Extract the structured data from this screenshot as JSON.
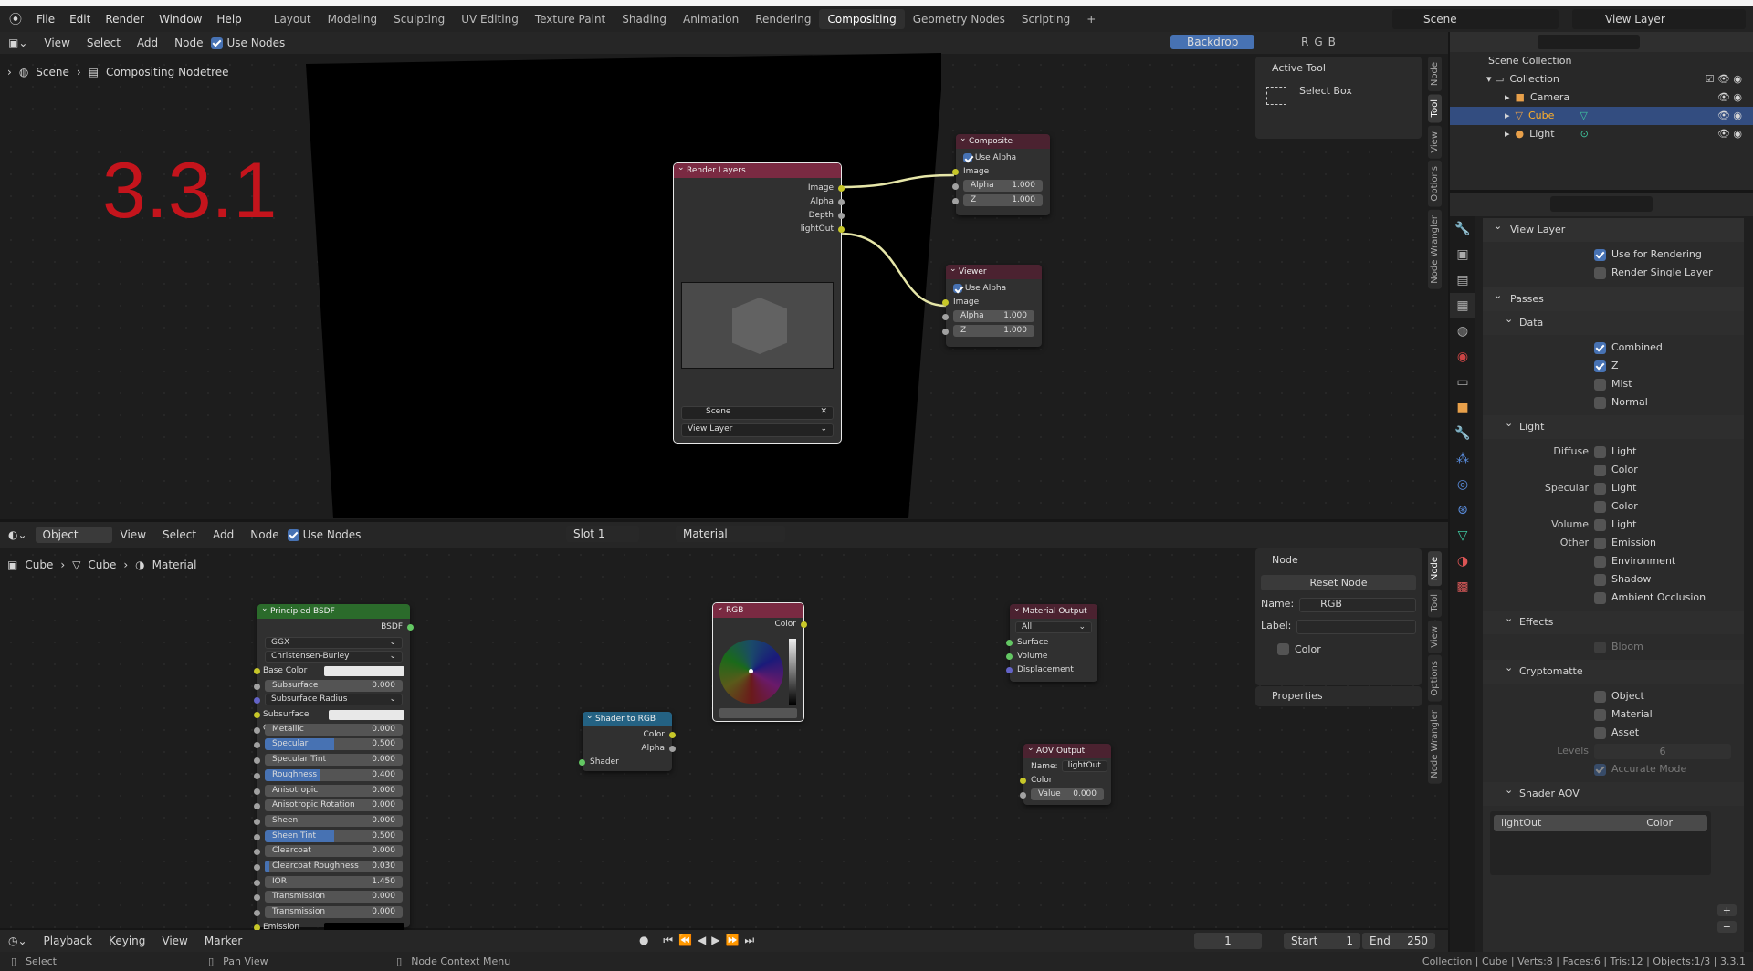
{
  "topbar": {
    "menus": [
      "File",
      "Edit",
      "Render",
      "Window",
      "Help"
    ],
    "workspaces": [
      "Layout",
      "Modeling",
      "Sculpting",
      "UV Editing",
      "Texture Paint",
      "Shading",
      "Animation",
      "Rendering",
      "Compositing",
      "Geometry Nodes",
      "Scripting"
    ],
    "active_workspace": "Compositing",
    "add": "+",
    "scene": "Scene",
    "view_layer": "View Layer"
  },
  "compositor": {
    "menus": [
      "View",
      "Select",
      "Add",
      "Node"
    ],
    "use_nodes": "Use Nodes",
    "backdrop": "Backdrop",
    "channels": [
      "R",
      "G",
      "B"
    ],
    "breadcrumb": [
      "Scene",
      "Compositing Nodetree"
    ],
    "version_watermark": "3.3.1",
    "render_layers": {
      "title": "Render Layers",
      "outputs": [
        "Image",
        "Alpha",
        "Depth",
        "lightOut"
      ],
      "scene": "Scene",
      "view_layer": "View Layer"
    },
    "composite": {
      "title": "Composite",
      "use_alpha": "Use Alpha",
      "input": "Image",
      "alpha_label": "Alpha",
      "alpha": "1.000",
      "z_label": "Z",
      "z": "1.000"
    },
    "viewer": {
      "title": "Viewer",
      "use_alpha": "Use Alpha",
      "input": "Image",
      "alpha_label": "Alpha",
      "alpha": "1.000",
      "z_label": "Z",
      "z": "1.000"
    },
    "npanel": {
      "title": "Active Tool",
      "tool": "Select Box"
    },
    "tabs": [
      "Node",
      "Tool",
      "View",
      "Options",
      "Node Wrangler"
    ]
  },
  "shader": {
    "mode": "Object",
    "menus": [
      "View",
      "Select",
      "Add",
      "Node"
    ],
    "use_nodes": "Use Nodes",
    "slot": "Slot 1",
    "material": "Material",
    "breadcrumb": [
      "Cube",
      "Cube",
      "Material"
    ],
    "principled": {
      "title": "Principled BSDF",
      "output": "BSDF",
      "distribution": "GGX",
      "subsurface_method": "Christensen-Burley",
      "rows": [
        {
          "label": "Base Color",
          "type": "color",
          "color": "#e8e8e8",
          "socket": "yel"
        },
        {
          "label": "Subsurface",
          "value": "0.000",
          "fill": 0,
          "socket": "gry"
        },
        {
          "label": "Subsurface Radius",
          "type": "drop",
          "socket": "pur"
        },
        {
          "label": "Subsurface Color",
          "type": "color",
          "color": "#e8e8e8",
          "socket": "yel"
        },
        {
          "label": "Metallic",
          "value": "0.000",
          "fill": 0,
          "socket": "gry"
        },
        {
          "label": "Specular",
          "value": "0.500",
          "fill": 0.5,
          "socket": "gry"
        },
        {
          "label": "Specular Tint",
          "value": "0.000",
          "fill": 0,
          "socket": "gry"
        },
        {
          "label": "Roughness",
          "value": "0.400",
          "fill": 0.4,
          "socket": "gry"
        },
        {
          "label": "Anisotropic",
          "value": "0.000",
          "fill": 0,
          "socket": "gry"
        },
        {
          "label": "Anisotropic Rotation",
          "value": "0.000",
          "fill": 0,
          "socket": "gry"
        },
        {
          "label": "Sheen",
          "value": "0.000",
          "fill": 0,
          "socket": "gry"
        },
        {
          "label": "Sheen Tint",
          "value": "0.500",
          "fill": 0.5,
          "socket": "gry"
        },
        {
          "label": "Clearcoat",
          "value": "0.000",
          "fill": 0,
          "socket": "gry"
        },
        {
          "label": "Clearcoat Roughness",
          "value": "0.030",
          "fill": 0.03,
          "socket": "gry"
        },
        {
          "label": "IOR",
          "value": "1.450",
          "fill": 0,
          "socket": "gry"
        },
        {
          "label": "Transmission",
          "value": "0.000",
          "fill": 0,
          "socket": "gry"
        },
        {
          "label": "Transmission Roughness",
          "value": "0.000",
          "fill": 0,
          "socket": "gry"
        },
        {
          "label": "Emission",
          "type": "color",
          "color": "#000000",
          "socket": "yel"
        }
      ]
    },
    "shader_to_rgb": {
      "title": "Shader to RGB",
      "outputs": [
        "Color",
        "Alpha"
      ],
      "input": "Shader"
    },
    "rgb": {
      "title": "RGB",
      "output": "Color"
    },
    "material_output": {
      "title": "Material Output",
      "target": "All",
      "inputs": [
        "Surface",
        "Volume",
        "Displacement"
      ]
    },
    "aov_output": {
      "title": "AOV Output",
      "name_label": "Name:",
      "name": "lightOut",
      "input": "Color",
      "value_label": "Value",
      "value": "0.000"
    },
    "npanel": {
      "title": "Node",
      "reset": "Reset Node",
      "name_label": "Name:",
      "name": "RGB",
      "label_label": "Label:",
      "label": "",
      "color": "Color",
      "properties": "Properties"
    },
    "tabs": [
      "Node",
      "Tool",
      "View",
      "Options",
      "Node Wrangler"
    ]
  },
  "timeline": {
    "menus": [
      "Playback",
      "Keying",
      "View",
      "Marker"
    ],
    "current_frame": "1",
    "start_label": "Start",
    "start": "1",
    "end_label": "End",
    "end": "250"
  },
  "outliner": {
    "root": "Scene Collection",
    "collection": "Collection",
    "items": [
      {
        "name": "Camera",
        "color": "#e8a04a"
      },
      {
        "name": "Cube",
        "color": "#e8a04a",
        "selected": true
      },
      {
        "name": "Light",
        "color": "#e8a04a"
      }
    ]
  },
  "properties": {
    "view_layer": {
      "title": "View Layer",
      "use_for_rendering": "Use for Rendering",
      "render_single_layer": "Render Single Layer"
    },
    "passes": {
      "title": "Passes",
      "data": {
        "title": "Data",
        "items": [
          {
            "label": "Combined",
            "checked": true
          },
          {
            "label": "Z",
            "checked": true
          },
          {
            "label": "Mist",
            "checked": false
          },
          {
            "label": "Normal",
            "checked": false
          }
        ]
      },
      "light": {
        "title": "Light",
        "rows": [
          {
            "group": "Diffuse",
            "label": "Light"
          },
          {
            "group": "",
            "label": "Color"
          },
          {
            "group": "Specular",
            "label": "Light"
          },
          {
            "group": "",
            "label": "Color"
          },
          {
            "group": "Volume",
            "label": "Light"
          },
          {
            "group": "Other",
            "label": "Emission"
          },
          {
            "group": "",
            "label": "Environment"
          },
          {
            "group": "",
            "label": "Shadow"
          },
          {
            "group": "",
            "label": "Ambient Occlusion"
          }
        ]
      },
      "effects": {
        "title": "Effects",
        "bloom": "Bloom"
      },
      "cryptomatte": {
        "title": "Cryptomatte",
        "items": [
          "Object",
          "Material",
          "Asset"
        ],
        "levels_label": "Levels",
        "levels": "6",
        "accurate": "Accurate Mode"
      },
      "shader_aov": {
        "title": "Shader AOV",
        "name": "lightOut",
        "type": "Color"
      }
    }
  },
  "status": {
    "select": "Select",
    "pan": "Pan View",
    "context": "Node Context Menu",
    "info": "Collection | Cube | Verts:8 | Faces:6 | Tris:12 | Objects:1/3 | 3.3.1"
  }
}
